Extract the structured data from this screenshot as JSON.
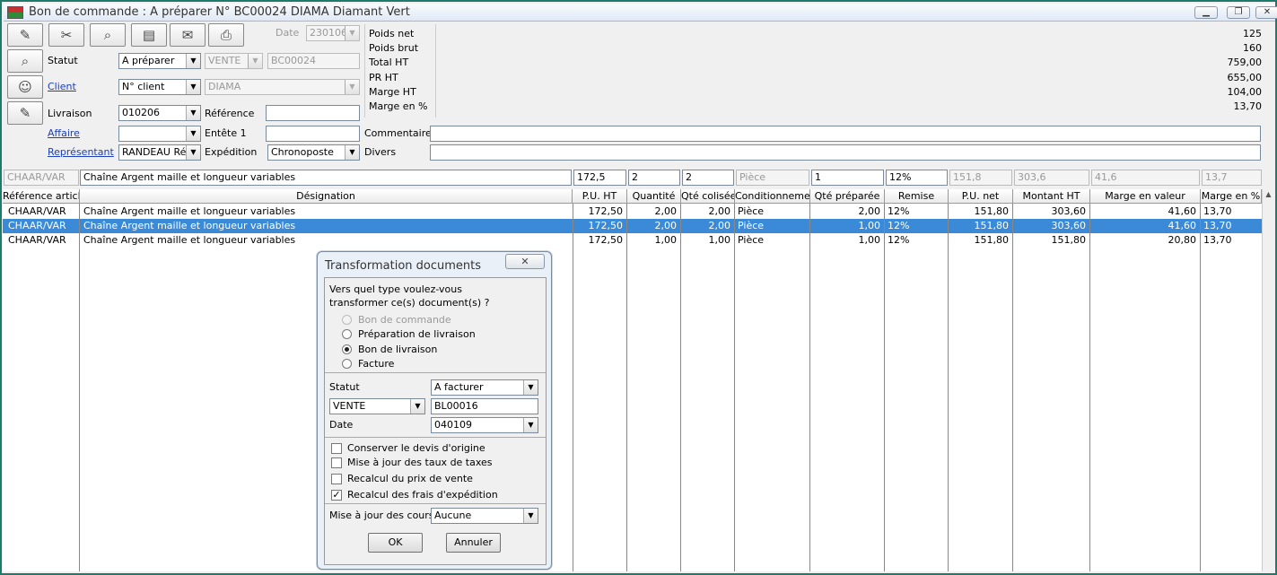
{
  "window": {
    "title": "Bon de commande : A préparer N° BC00024 DIAMA Diamant Vert"
  },
  "colors": {
    "selection": "#3b8ad8",
    "frame": "#1e7a6a",
    "link": "#1a3fb8"
  },
  "toolbar": {
    "icons": [
      "edit-icon",
      "tools-icon",
      "search-icon",
      "book-icon",
      "mail-icon",
      "print-icon"
    ]
  },
  "side_icons": [
    "search-person-icon",
    "client-icon",
    "delivery-icon"
  ],
  "header": {
    "date_label": "Date",
    "date_value": "230106",
    "statut_label": "Statut",
    "statut_value": "A préparer",
    "type_value": "VENTE",
    "numero_value": "BC00024",
    "client_label": "Client",
    "client_select": "N° client",
    "client_value": "DIAMA",
    "livraison_label": "Livraison",
    "livraison_value": "010206",
    "reference_label": "Référence",
    "reference_value": "",
    "affaire_label": "Affaire",
    "affaire_value": "",
    "entete_label": "Entête 1",
    "entete_value": "",
    "representant_label": "Représentant",
    "representant_value": "RANDEAU Ré",
    "expedition_label": "Expédition",
    "expedition_value": "Chronoposte",
    "commentaires_label": "Commentaires",
    "commentaires_value": "",
    "divers_label": "Divers",
    "divers_value": ""
  },
  "totals": [
    {
      "label": "Poids net",
      "value": "125"
    },
    {
      "label": "Poids brut",
      "value": "160"
    },
    {
      "label": "Total HT",
      "value": "759,00"
    },
    {
      "label": "PR HT",
      "value": "655,00"
    },
    {
      "label": "Marge HT",
      "value": "104,00"
    },
    {
      "label": "Marge en %",
      "value": "13,70"
    }
  ],
  "edit_row": [
    "CHAAR/VAR",
    "Chaîne Argent maille et longueur variables",
    "172,5",
    "2",
    "2",
    "Pièce",
    "1",
    "12%",
    "151,8",
    "303,6",
    "41,6",
    "13,7"
  ],
  "columns": [
    "Référence article",
    "Désignation",
    "P.U. HT",
    "Quantité",
    "Qté colisée",
    "Conditionnement",
    "Qté préparée",
    "Remise",
    "P.U. net",
    "Montant HT",
    "Marge en valeur",
    "Marge en %"
  ],
  "rows": [
    [
      "CHAAR/VAR",
      "Chaîne Argent maille et longueur variables",
      "172,50",
      "2,00",
      "2,00",
      "Pièce",
      "2,00",
      "12%",
      "151,80",
      "303,60",
      "41,60",
      "13,70"
    ],
    [
      "CHAAR/VAR",
      "Chaîne Argent maille et longueur variables",
      "172,50",
      "2,00",
      "2,00",
      "Pièce",
      "1,00",
      "12%",
      "151,80",
      "303,60",
      "41,60",
      "13,70"
    ],
    [
      "CHAAR/VAR",
      "Chaîne Argent maille et longueur variables",
      "172,50",
      "1,00",
      "1,00",
      "Pièce",
      "1,00",
      "12%",
      "151,80",
      "151,80",
      "20,80",
      "13,70"
    ]
  ],
  "dialog": {
    "title": "Transformation documents",
    "question_line1": "Vers quel type voulez-vous",
    "question_line2": "transformer ce(s) document(s) ?",
    "options": [
      "Bon de commande",
      "Préparation de livraison",
      "Bon de livraison",
      "Facture"
    ],
    "selected_option": "Bon de livraison",
    "statut_label": "Statut",
    "statut_value": "A facturer",
    "type_value": "VENTE",
    "numero_value": "BL00016",
    "date_label": "Date",
    "date_value": "040109",
    "checks": [
      {
        "label": "Conserver le devis d'origine",
        "checked": false
      },
      {
        "label": "Mise à jour des taux de taxes",
        "checked": false
      },
      {
        "label": "Recalcul du prix de vente",
        "checked": false
      },
      {
        "label": "Recalcul des frais d'expédition",
        "checked": true
      }
    ],
    "cours_label": "Mise à jour des cours",
    "cours_value": "Aucune",
    "ok_label": "OK",
    "cancel_label": "Annuler"
  }
}
